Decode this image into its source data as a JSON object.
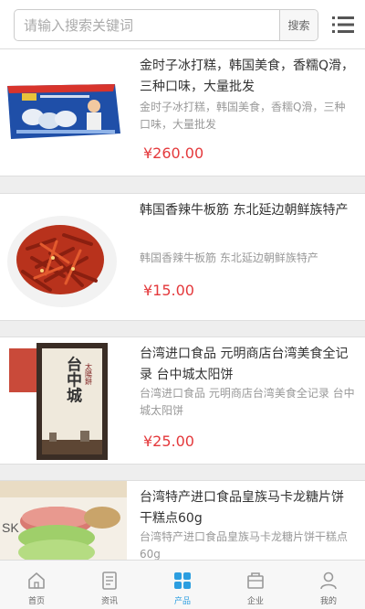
{
  "search": {
    "placeholder": "请输入搜索关键词",
    "button_label": "搜索"
  },
  "products": [
    {
      "title": "金时子冰打糕，韩国美食，香糯Q滑，三种口味，大量批发",
      "desc": "金时子冰打糕，韩国美食，香糯Q滑，三种口味，大量批发",
      "price": "¥260.00",
      "image_icon": "ice-rice-cake-box-image"
    },
    {
      "title": "韩国香辣牛板筋 东北延边朝鲜族特产",
      "desc": "韩国香辣牛板筋 东北延边朝鲜族特产",
      "price": "¥15.00",
      "image_icon": "spicy-beef-tendon-image"
    },
    {
      "title": "台湾进口食品 元明商店台湾美食全记录 台中城太阳饼",
      "desc": "台湾进口食品 元明商店台湾美食全记录 台中城太阳饼",
      "price": "¥25.00",
      "image_icon": "taichung-sun-cake-box-image"
    },
    {
      "title": "台湾特产进口食品皇族马卡龙糖片饼干糕点60g",
      "desc": "台湾特产进口食品皇族马卡龙糖片饼干糕点60g",
      "price": "",
      "image_icon": "macaron-cookie-image"
    }
  ],
  "box_text": {
    "brand": "台中城",
    "side": "太陽餅",
    "badge": "SK"
  },
  "tabs": [
    {
      "label": "首页",
      "icon": "home-icon"
    },
    {
      "label": "资讯",
      "icon": "news-icon"
    },
    {
      "label": "产品",
      "icon": "grid-icon"
    },
    {
      "label": "企业",
      "icon": "company-icon"
    },
    {
      "label": "我的",
      "icon": "user-icon"
    }
  ],
  "colors": {
    "price": "#e4393c",
    "active_tab": "#2c9ee0",
    "inactive_tab": "#999999"
  }
}
